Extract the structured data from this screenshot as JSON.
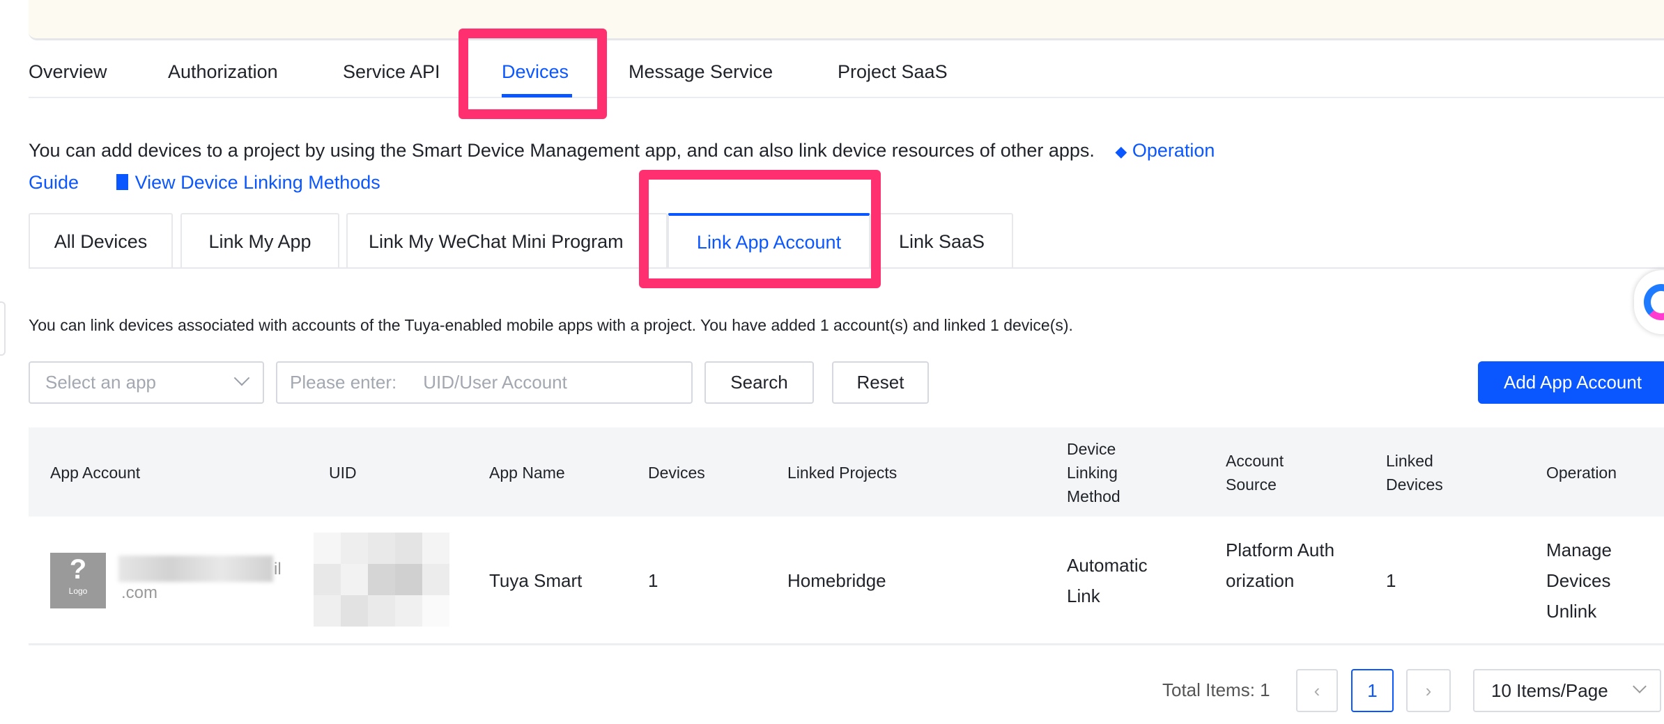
{
  "top_tabs": [
    "Overview",
    "Authorization",
    "Service API",
    "Devices",
    "Message Service",
    "Project SaaS"
  ],
  "active_top_tab": "Devices",
  "description": {
    "text": "You can add devices to a project by using the Smart Device Management app, and can also link device resources of other apps.",
    "guide_part1": "Operation",
    "guide_part2": "Guide",
    "view_methods": "View Device Linking Methods"
  },
  "sub_tabs": [
    "All Devices",
    "Link My App",
    "Link My WeChat Mini Program",
    "Link App Account",
    "Link SaaS"
  ],
  "active_sub_tab": "Link App Account",
  "info": "You can link devices associated with accounts of the Tuya-enabled mobile apps with a project. You have added 1 account(s) and linked 1 device(s).",
  "filters": {
    "select_placeholder": "Select an app",
    "input_label": "Please enter:",
    "input_placeholder": "UID/User Account",
    "search": "Search",
    "reset": "Reset",
    "add": "Add App Account"
  },
  "table": {
    "headers": [
      "App Account",
      "UID",
      "App Name",
      "Devices",
      "Linked Projects",
      "Device Linking Method",
      "Account Source",
      "Linked Devices",
      "Operation"
    ],
    "rows": [
      {
        "logo_text": "Logo",
        "account_visible_1": "il",
        "account_visible_2": ".com",
        "app_name": "Tuya Smart",
        "devices": "1",
        "linked_projects": "Homebridge",
        "method": "Automatic Link",
        "source": "Platform Authorization",
        "linked_devices": "1",
        "op_manage": "Manage Devices",
        "op_unlink": "Unlink"
      }
    ]
  },
  "pagination": {
    "total": "Total Items: 1",
    "current_page": "1",
    "page_size": "10 Items/Page"
  },
  "colors": {
    "accent": "#0a56ff",
    "highlight": "#ff2f70"
  }
}
